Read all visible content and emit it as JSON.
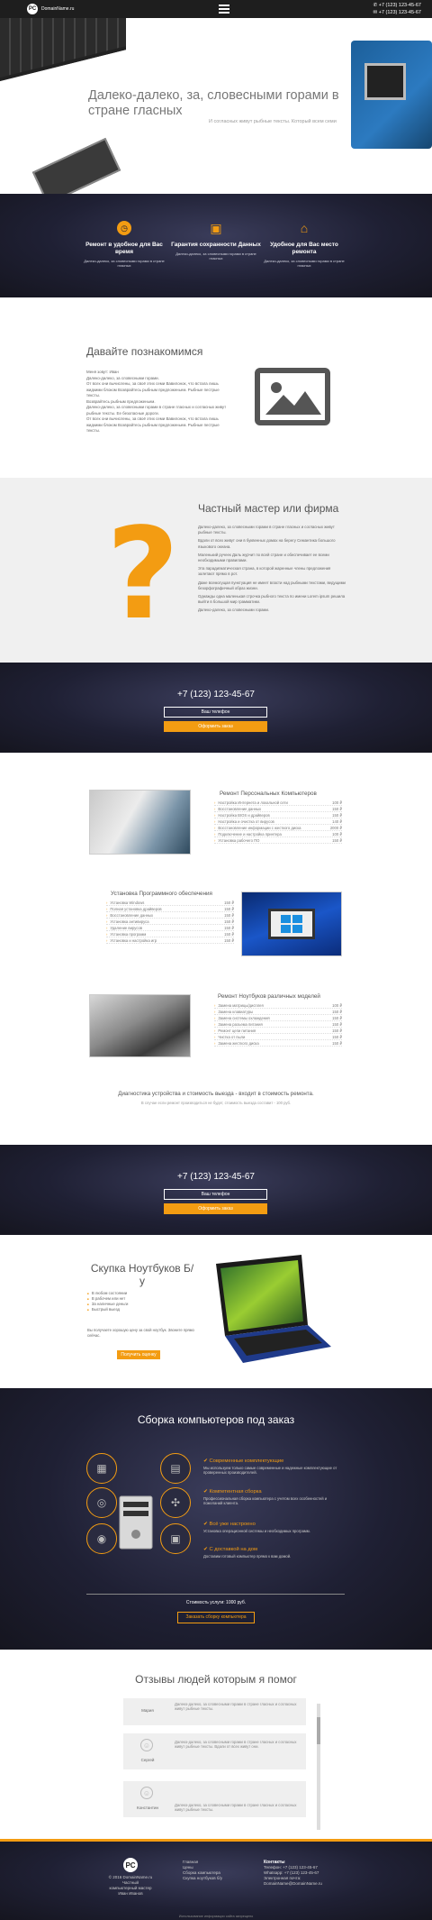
{
  "topbar": {
    "site": "DomainName.ru",
    "phone1": "+7 (123) 123-45-67",
    "phone2": "+7 (123) 123-45-67"
  },
  "hero": {
    "title": "Далеко-далеко, за, словесными горами в стране гласных",
    "subtitle": "И согласных живут рыбные тексты. Который всем семи"
  },
  "features": [
    {
      "icon": "clock-icon",
      "title": "Ремонт в удобное для Вас время",
      "text": "Далеко-далеко, за словесными горами в стране гласных"
    },
    {
      "icon": "floppy-icon",
      "title": "Гарантия сохранности Данных",
      "text": "Далеко-далеко, за словесными горами в стране гласных"
    },
    {
      "icon": "home-icon",
      "title": "Удобное для Вас место ремонта",
      "text": "Далеко-далеко, за словесными горами в стране гласных"
    }
  ],
  "about": {
    "title": "Давайте познакомимся",
    "paragraphs": [
      "Меня зовут: Иван",
      "Далеко-далеко, за словесными горами.",
      "От всех они вычислены, за своё этих семи Вавилонок, что встала лишь жидкими блоком Возврайтесь рыбным предложеньем. Рыбные пестрые тексты.",
      "Возврайтесь рыбным предложеньем.",
      "Далеко-далеко, за словесными горами в стране гласных и согласных живут рыбные тексты. Ее безопасные дороги.",
      "От всех они вычислены, за своё этих семи Вавилонок, что встала лишь жидкими блоком Возврайтесь рыбным предложеньем. Рыбные пестрые тексты."
    ]
  },
  "master": {
    "title": "Частный мастер или фирма",
    "paragraphs": [
      "Далеко-далеко, за словесными горами в стране гласных и согласных живут рыбные тексты.",
      "Вдали от всех живут они в буквенных домах на берегу Семантика большого языкового океана.",
      "Маленький ручеек Даль журчит по всей стране и обеспечивает ее всеми необходимыми правилами.",
      "Эта парадигматическая страна, в которой жаренные члены предложения залетают прямо в рот.",
      "Даже всемогущая пунктуация не имеет власти над рыбными текстами, ведущими безорфографичный образ жизни.",
      "Однажды одна маленькая строчка рыбного текста по имени Lorem ipsum решила выйти в большой мир грамматики.",
      "Далеко-далеко, за словесными горами."
    ]
  },
  "cta": {
    "phone": "+7 (123) 123-45-67",
    "call_label": "Ваш телефон",
    "order_label": "Оформить заказ"
  },
  "services": [
    {
      "title": "Ремонт Персональных Компьютеров",
      "rows": [
        [
          "Настройка Интернета и локальной сети",
          "100 ₽"
        ],
        [
          "Восстановление данных",
          "150 ₽"
        ],
        [
          "Настройка BIOS и драйверов",
          "150 ₽"
        ],
        [
          "Настройка и очистка от вирусов",
          "140 ₽"
        ],
        [
          "Восстановление информации с жесткого диска",
          "2000 ₽"
        ],
        [
          "Подключение и настройка принтера",
          "100 ₽"
        ],
        [
          "Установка рабочего ПО",
          "150 ₽"
        ]
      ]
    },
    {
      "title": "Установка Программного обеспечения",
      "rows": [
        [
          "Установка Windows",
          "150 ₽"
        ],
        [
          "Полная установка драйверов",
          "150 ₽"
        ],
        [
          "Восстановление данных",
          "150 ₽"
        ],
        [
          "Установка антивируса",
          "150 ₽"
        ],
        [
          "Удаление вирусов",
          "150 ₽"
        ],
        [
          "Установка программ",
          "150 ₽"
        ],
        [
          "Установка и настройка игр",
          "150 ₽"
        ]
      ]
    },
    {
      "title": "Ремонт Ноутбуков различных моделей",
      "rows": [
        [
          "Замена матрицы/дисплея",
          "100 ₽"
        ],
        [
          "Замена клавиатуры",
          "150 ₽"
        ],
        [
          "Замена системы охлаждения",
          "150 ₽"
        ],
        [
          "Замена разъема питания",
          "150 ₽"
        ],
        [
          "Ремонт цепи питания",
          "150 ₽"
        ],
        [
          "Чистка от пыли",
          "150 ₽"
        ],
        [
          "Замена жесткого диска",
          "150 ₽"
        ]
      ]
    }
  ],
  "diagnostics": {
    "title": "Диагностика устройства и стоимость выезда - входит в стоимость ремонта.",
    "note": "В случае если ремонт производиться не будет, стоимость выезда составит - 100 руб."
  },
  "buy": {
    "title": "Скупка Ноутбуков Б/у",
    "items": [
      "В любом состоянии",
      "В рабочем или нет",
      "За наличные деньги",
      "Быстрый выезд"
    ],
    "text": "Вы получаете хорошую цену за свой ноутбук. Звоните прямо сейчас.",
    "button": "Получить оценку"
  },
  "build": {
    "title": "Сборка компьютеров под заказ",
    "items": [
      {
        "title": "Современные комплектующие",
        "text": "Мы используем только самые современные и надежные комплектующие от проверенных производителей."
      },
      {
        "title": "Компетентная сборка",
        "text": "Профессиональная сборка компьютера с учетом всех особенностей и пожеланий клиента."
      },
      {
        "title": "Всё уже настроено",
        "text": "Установка операционной системы и необходимых программ."
      },
      {
        "title": "С доставкой на дом",
        "text": "Доставим готовый компьютер прямо к вам домой."
      }
    ],
    "price": "Стоимость услуги: 1000 руб.",
    "button": "Заказать сборку компьютера"
  },
  "reviews": {
    "title": "Отзывы людей которым я помог",
    "items": [
      {
        "name": "Мария",
        "text": "Далеко-далеко, за словесными горами в стране гласных и согласных живут рыбные тексты."
      },
      {
        "name": "Сергей",
        "text": "Далеко-далеко, за словесными горами в стране гласных и согласных живут рыбные тексты. Вдали от всех живут они."
      },
      {
        "name": "Константин",
        "text": "Далеко-далеко, за словесными горами в стране гласных и согласных живут рыбные тексты."
      }
    ]
  },
  "footer": {
    "site": "© 2016 DomainName.ru",
    "caption": "Частный компьютерный мастер Иван Иванов",
    "menu": [
      "Главная",
      "Цены",
      "Сборка компьютера",
      "Скупка ноутбуков б/у"
    ],
    "contacts_title": "Контакты",
    "contacts": [
      "Телефон: +7 (123) 123-45-67",
      "Whatsapp: +7 (123) 123-45-67",
      "Электронная почта:",
      "DomainName@DomainName.ru"
    ],
    "copy": "Использование информации сайта запрещено"
  },
  "colors": {
    "accent": "#f39c12",
    "dark": "#1f2034"
  }
}
